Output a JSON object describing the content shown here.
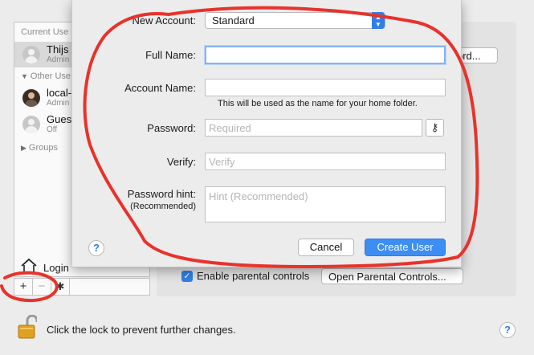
{
  "sidebar": {
    "current_users_header": "Current Use",
    "other_users_header": "Other Use",
    "groups_label": "Groups",
    "users": [
      {
        "name": "Thijs",
        "role": "Admin",
        "selected": true
      },
      {
        "name": "local-",
        "role": "Admin",
        "selected": false
      },
      {
        "name": "Gues",
        "role": "Off",
        "selected": false
      }
    ],
    "login_label": "Login",
    "add_symbol": "+",
    "remove_symbol": "−",
    "gear_symbol": "✱"
  },
  "panel": {
    "password_button_label": "ord...",
    "parental_checkbox_label": "Enable parental controls",
    "parental_checked": true,
    "open_parental_button": "Open Parental Controls..."
  },
  "footer": {
    "lock_text": "Click the lock to prevent further changes.",
    "help_symbol": "?"
  },
  "dialog": {
    "new_account_label": "New Account:",
    "account_type": "Standard",
    "full_name_label": "Full Name:",
    "full_name_value": "",
    "account_name_label": "Account Name:",
    "account_name_value": "",
    "account_name_note": "This will be used as the name for your home folder.",
    "password_label": "Password:",
    "password_placeholder": "Required",
    "key_symbol": "⚷",
    "verify_label": "Verify:",
    "verify_placeholder": "Verify",
    "hint_label": "Password hint:",
    "hint_sublabel": "(Recommended)",
    "hint_placeholder": "Hint (Recommended)",
    "help_symbol": "?",
    "cancel_label": "Cancel",
    "create_label": "Create User"
  },
  "colors": {
    "accent": "#3d8ef2",
    "annotation": "#e8322b"
  }
}
